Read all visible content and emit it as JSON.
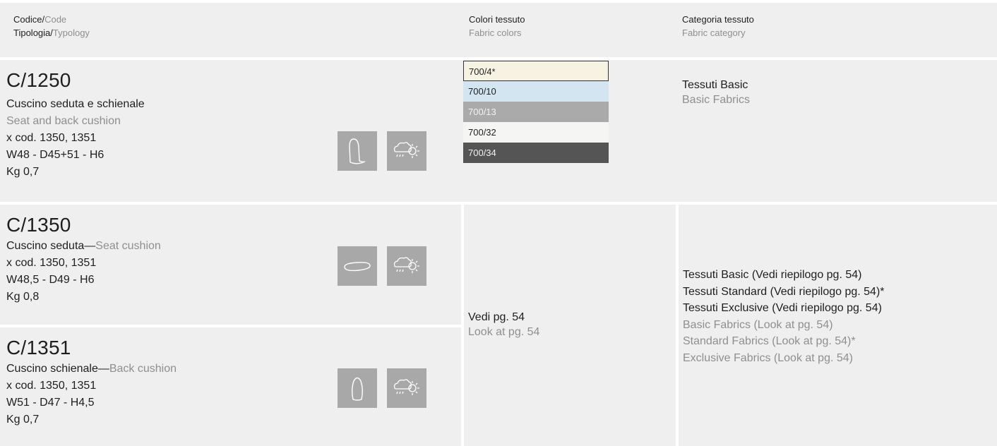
{
  "header": {
    "code_it": "Codice/",
    "code_en": "Code",
    "typology_it": "Tipologia/",
    "typology_en": "Typology",
    "colors_it": "Colori tessuto",
    "colors_en": "Fabric colors",
    "category_it": "Categoria tessuto",
    "category_en": "Fabric category"
  },
  "colors": {
    "bg": "#efefef",
    "icon_bg": "#a8a8a8",
    "secondary_text": "#8f8f8f"
  },
  "products": [
    {
      "code": "C/1250",
      "name_it": "Cuscino seduta e schienale",
      "name_en": "Seat and back cushion",
      "compat": "x cod. 1350, 1351",
      "dims": "W48 - D45+51 - H6",
      "weight": "Kg 0,7",
      "icons": [
        "seat-and-back-cushion-icon",
        "weather-resistant-icon"
      ]
    },
    {
      "code": "C/1350",
      "name_it": "Cuscino seduta",
      "sep": "—",
      "name_en": "Seat cushion",
      "compat": "x cod. 1350, 1351",
      "dims": "W48,5 - D49 - H6",
      "weight": "Kg 0,8",
      "icons": [
        "seat-cushion-icon",
        "weather-resistant-icon"
      ]
    },
    {
      "code": "C/1351",
      "name_it": "Cuscino schienale",
      "sep": "—",
      "name_en": "Back cushion",
      "compat": "x cod. 1350, 1351",
      "dims": "W51 - D47 - H4,5",
      "weight": "Kg 0,7",
      "icons": [
        "back-cushion-icon",
        "weather-resistant-icon"
      ]
    }
  ],
  "swatches": [
    {
      "label": "700/4*",
      "color": "#f7f3e3",
      "text_color": "#1e1e1e"
    },
    {
      "label": "700/10",
      "color": "#d3e5f0",
      "text_color": "#1e1e1e"
    },
    {
      "label": "700/13",
      "color": "#aaaaaa",
      "text_color": "#f2f2f2"
    },
    {
      "label": "700/32",
      "color": "#f5f5f3",
      "text_color": "#1e1e1e"
    },
    {
      "label": "700/34",
      "color": "#555555",
      "text_color": "#f2f2f2"
    }
  ],
  "row1_category": {
    "it": "Tessuti Basic",
    "en": "Basic Fabrics"
  },
  "shared_colors": {
    "it": "Vedi pg. 54",
    "en": "Look at pg. 54"
  },
  "shared_category": {
    "it": [
      "Tessuti Basic (Vedi riepilogo pg. 54)",
      "Tessuti Standard (Vedi riepilogo pg. 54)*",
      "Tessuti Exclusive (Vedi riepilogo pg. 54)"
    ],
    "en": [
      "Basic Fabrics (Look at pg. 54)",
      "Standard Fabrics (Look at pg. 54)*",
      "Exclusive Fabrics (Look at pg. 54)"
    ]
  }
}
